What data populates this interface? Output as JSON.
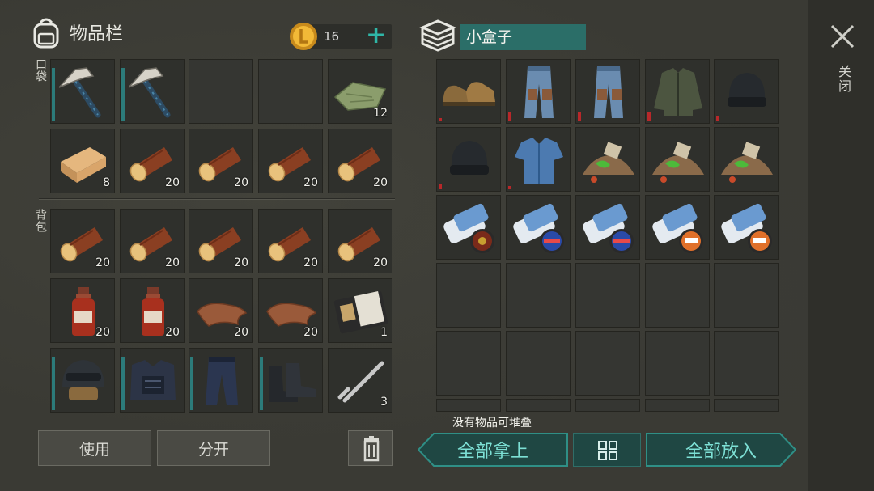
{
  "inventory": {
    "title": "物品栏",
    "coins": "16",
    "add_icon": "+",
    "pocket_label": "口袋",
    "backpack_label": "背包",
    "pocket_slots": [
      {
        "item": "pickaxe-icon",
        "count": "",
        "durability": true
      },
      {
        "item": "pickaxe-icon",
        "count": "",
        "durability": true
      },
      {
        "item": "",
        "count": ""
      },
      {
        "item": "",
        "count": ""
      },
      {
        "item": "cloth-icon",
        "count": "12"
      },
      {
        "item": "plank-icon",
        "count": "8"
      },
      {
        "item": "log-icon",
        "count": "20"
      },
      {
        "item": "log-icon",
        "count": "20"
      },
      {
        "item": "log-icon",
        "count": "20"
      },
      {
        "item": "log-icon",
        "count": "20"
      }
    ],
    "backpack_slots": [
      {
        "item": "log-icon",
        "count": "20"
      },
      {
        "item": "log-icon",
        "count": "20"
      },
      {
        "item": "log-icon",
        "count": "20"
      },
      {
        "item": "log-icon",
        "count": "20"
      },
      {
        "item": "log-icon",
        "count": "20"
      },
      {
        "item": "bottle-icon",
        "count": "20"
      },
      {
        "item": "bottle-icon",
        "count": "20"
      },
      {
        "item": "leather-icon",
        "count": "20"
      },
      {
        "item": "leather-icon",
        "count": "20"
      },
      {
        "item": "wallet-icon",
        "count": "1"
      },
      {
        "item": "helmet-icon",
        "count": "",
        "durability": true
      },
      {
        "item": "vest-icon",
        "count": "",
        "durability": true
      },
      {
        "item": "pants-icon",
        "count": "",
        "durability": true
      },
      {
        "item": "boots-icon",
        "count": "",
        "durability": true
      },
      {
        "item": "spring-icon",
        "count": "3"
      }
    ],
    "use_button": "使用",
    "split_button": "分开"
  },
  "container": {
    "name": "小盒子",
    "close_label": "关闭",
    "slots": [
      {
        "item": "shoes-icon",
        "damage": 0.05
      },
      {
        "item": "jeans-icon",
        "damage": 0.15
      },
      {
        "item": "jeans-icon",
        "damage": 0.15
      },
      {
        "item": "jacket-icon",
        "damage": 0.15
      },
      {
        "item": "beanie-icon",
        "damage": 0.08
      },
      {
        "item": "beanie-icon",
        "damage": 0.08
      },
      {
        "item": "shirt-icon",
        "damage": 0.05
      },
      {
        "item": "scrap-pile-icon"
      },
      {
        "item": "scrap-pile-icon"
      },
      {
        "item": "scrap-pile-icon"
      },
      {
        "item": "blueprint-icon",
        "badge": "red"
      },
      {
        "item": "blueprint-icon",
        "badge": "blue"
      },
      {
        "item": "blueprint-icon",
        "badge": "blue"
      },
      {
        "item": "blueprint-icon",
        "badge": "orange"
      },
      {
        "item": "blueprint-icon",
        "badge": "orange"
      }
    ],
    "empty_rows": 3,
    "stack_message": "没有物品可堆叠",
    "take_all_button": "全部拿上",
    "put_all_button": "全部放入"
  },
  "colors": {
    "accent_teal": "#2fb6a7",
    "button_teal_text": "#7de0d5",
    "durability_bar": "#2c7b7a",
    "damage_bar": "#b8282a"
  }
}
